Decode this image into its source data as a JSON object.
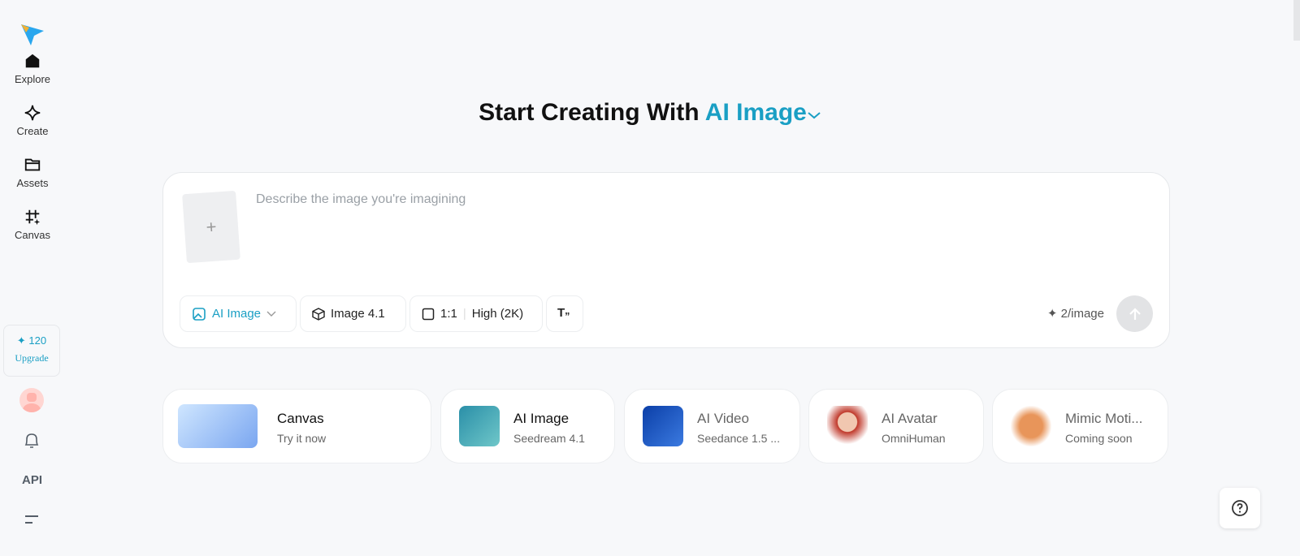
{
  "sidebar": {
    "nav": [
      {
        "label": "Explore"
      },
      {
        "label": "Create"
      },
      {
        "label": "Assets"
      },
      {
        "label": "Canvas"
      }
    ],
    "credits": "120",
    "upgrade": "Upgrade",
    "api": "API"
  },
  "header": {
    "prefix": "Start Creating With",
    "mode": "AI Image"
  },
  "prompt": {
    "placeholder": "Describe the image you're imagining",
    "upload": "+",
    "chips": {
      "mode": "AI Image",
      "model": "Image 4.1",
      "ratio": "1:1",
      "quality": "High (2K)"
    },
    "cost": "2/image"
  },
  "cards": [
    {
      "name": "Canvas",
      "sub": "Try it now"
    },
    {
      "name": "AI Image",
      "sub": "Seedream 4.1"
    },
    {
      "name": "AI Video",
      "sub": "Seedance 1.5 ..."
    },
    {
      "name": "AI Avatar",
      "sub": "OmniHuman"
    },
    {
      "name": "Mimic Moti...",
      "sub": "Coming soon"
    }
  ],
  "colors": {
    "accent": "#1a9fc4",
    "background": "#f7f8fa"
  }
}
